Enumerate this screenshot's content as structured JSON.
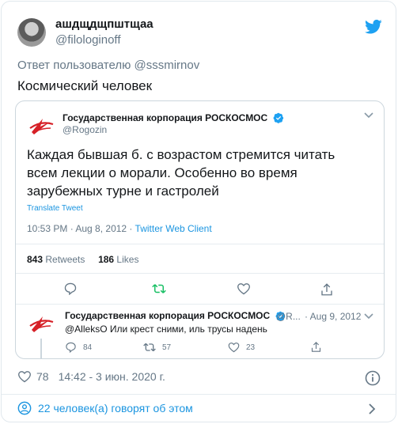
{
  "author": {
    "display_name": "ашдщдщпштщаа",
    "handle": "@filologinoff"
  },
  "reply_to": "Ответ пользователю @sssmirnov",
  "tweet_text": "Космический человек",
  "quoted": {
    "name": "Государственная корпорация РОСКОСМОС",
    "handle": "@Rogozin",
    "text_lines": [
      "Каждая бывшая б. с возрастом стремится читать",
      "всем лекции о морали. Особенно во время",
      "зарубежных турне и гастролей"
    ],
    "translate": "Translate Tweet",
    "time": "10:53 PM · Aug 8, 2012 · ",
    "client": "Twitter Web Client",
    "retweets_count": "843",
    "retweets_label": " Retweets",
    "likes_count": "186",
    "likes_label": " Likes"
  },
  "reply": {
    "name": "Государственная корпорация РОСКОСМОС",
    "handle": "@R...",
    "date": "· Aug 9, 2012",
    "text": "@AlleksO Или крест сними, иль трусы надень",
    "replies": "84",
    "retweets": "57",
    "likes": "23"
  },
  "footer": {
    "likes": "78",
    "timestamp": "14:42 - 3 июн. 2020 г.",
    "people_talking": "22 человек(а) говорят об этом"
  },
  "colors": {
    "accent": "#1da1f2",
    "link": "#1b95e0",
    "retweet_green": "#17bf63",
    "secondary_text": "#657786",
    "roscosmos_red": "#d62027"
  },
  "icons": [
    "twitter-bird-icon",
    "verified-icon",
    "chevron-down-icon",
    "reply-icon",
    "retweet-icon",
    "heart-icon",
    "share-icon",
    "info-icon",
    "person-icon",
    "chevron-right-icon"
  ]
}
